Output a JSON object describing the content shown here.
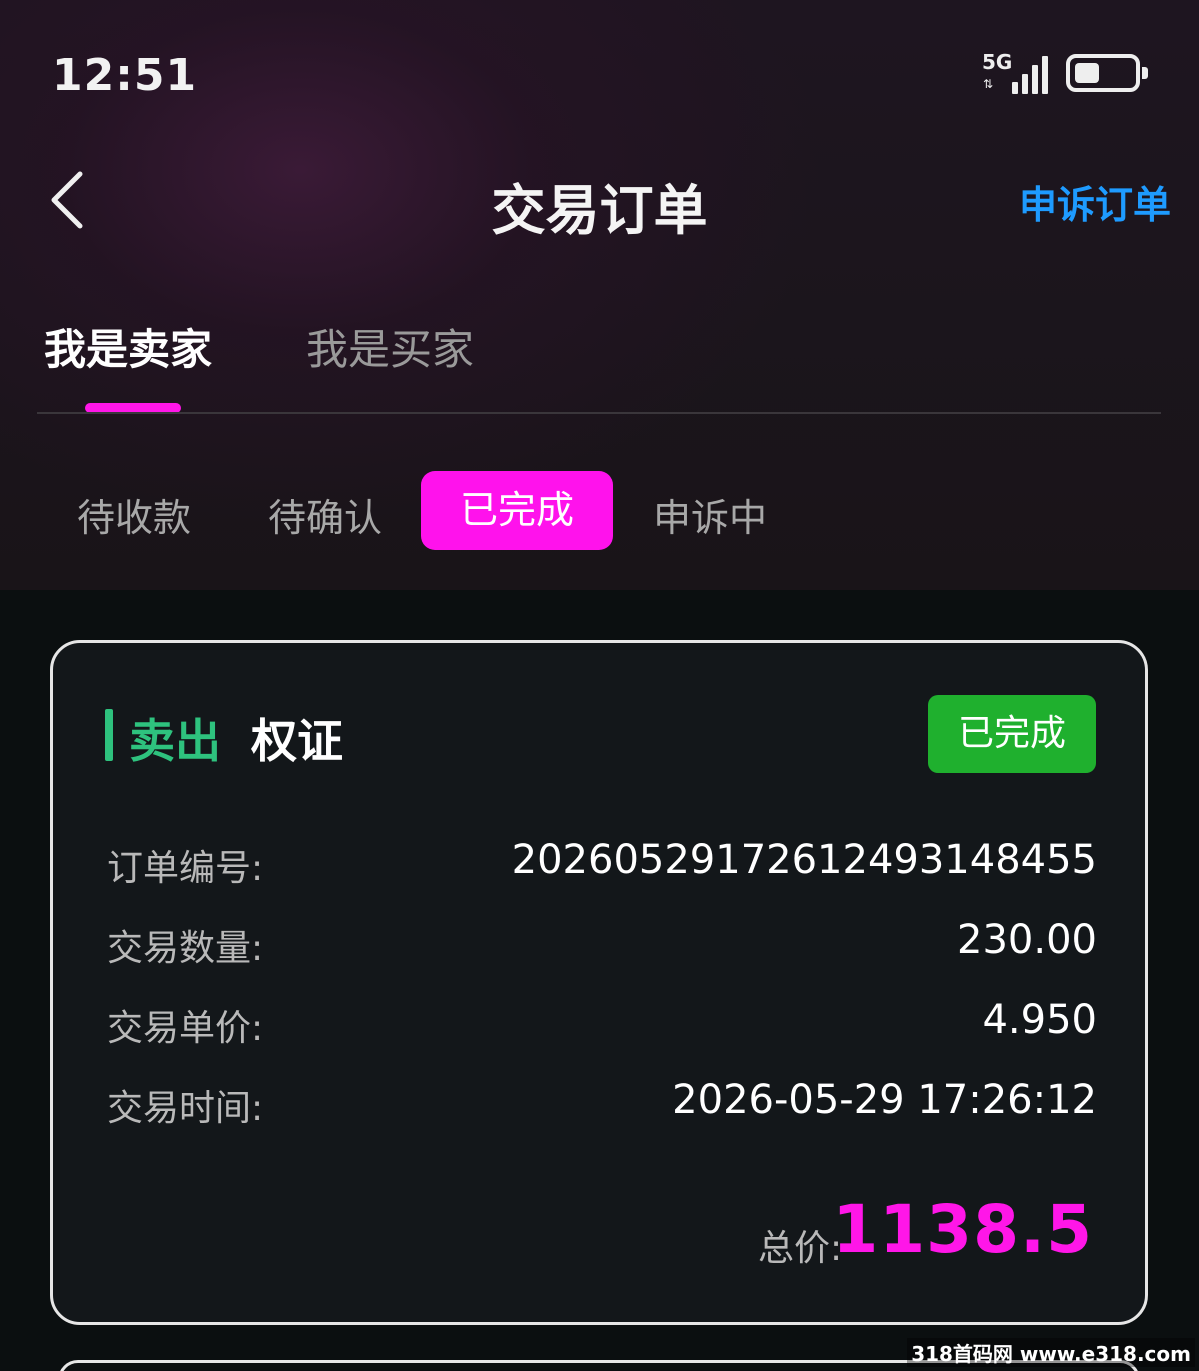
{
  "status_bar": {
    "time": "12:51",
    "network": "5G",
    "network_arrows": "⇅"
  },
  "header": {
    "back_icon": "chevron-left-icon",
    "title": "交易订单",
    "appeal_link": "申诉订单"
  },
  "role_tabs": [
    {
      "label": "我是卖家",
      "active": true
    },
    {
      "label": "我是买家",
      "active": false
    }
  ],
  "status_tabs": [
    {
      "label": "待收款",
      "active": false
    },
    {
      "label": "待确认",
      "active": false
    },
    {
      "label": "已完成",
      "active": true
    },
    {
      "label": "申诉中",
      "active": false
    }
  ],
  "order": {
    "trade_type": "卖出",
    "asset": "权证",
    "status": "已完成",
    "fields": [
      {
        "label": "订单编号:",
        "value": "202605291726124931484​55"
      },
      {
        "label": "交易数量:",
        "value": "230.00"
      },
      {
        "label": "交易单价:",
        "value": "4.950"
      },
      {
        "label": "交易时间:",
        "value": "2026-05-29 17:26:12"
      }
    ],
    "total_label": "总价:",
    "total_value": "1138.5"
  },
  "colors": {
    "accent": "#ff16e8",
    "link": "#1e9bff",
    "sell": "#2ec27e",
    "completed_badge": "#1fb02e"
  },
  "watermark": "318首码网 www.e318.com"
}
